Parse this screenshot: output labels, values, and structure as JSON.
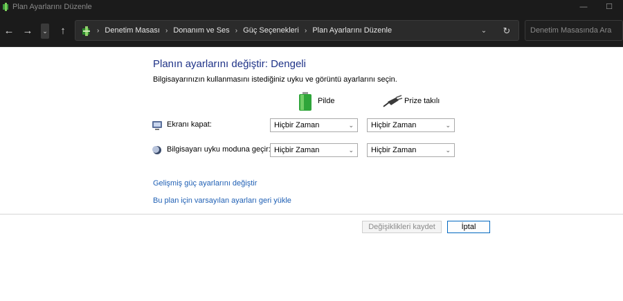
{
  "window": {
    "title": "Plan Ayarlarını Düzenle",
    "minimize_glyph": "—",
    "maximize_glyph": "☐"
  },
  "nav": {
    "back_glyph": "←",
    "forward_glyph": "→",
    "recent_glyph": "⌄",
    "up_glyph": "↑"
  },
  "address": {
    "icon": "control-panel-icon",
    "crumbs": [
      "Denetim Masası",
      "Donanım ve Ses",
      "Güç Seçenekleri",
      "Plan Ayarlarını Düzenle"
    ],
    "separator": "›",
    "dropdown_glyph": "⌄",
    "refresh_glyph": "↻"
  },
  "search": {
    "placeholder": "Denetim Masasında Ara"
  },
  "main": {
    "heading": "Planın ayarlarını değiştir: Dengeli",
    "subheading": "Bilgisayarınızın kullanmasını istediğiniz uyku ve görüntü ayarlarını seçin.",
    "columns": {
      "battery": "Pilde",
      "plugged": "Prize takılı"
    },
    "rows": {
      "display": {
        "label": "Ekranı kapat:",
        "battery_value": "Hiçbir Zaman",
        "plugged_value": "Hiçbir Zaman"
      },
      "sleep": {
        "label": "Bilgisayarı uyku moduna geçir:",
        "battery_value": "Hiçbir Zaman",
        "plugged_value": "Hiçbir Zaman"
      }
    },
    "links": {
      "advanced": "Gelişmiş güç ayarlarını değiştir",
      "restore": "Bu plan için varsayılan ayarları geri yükle"
    },
    "buttons": {
      "save": "Değişiklikleri kaydet",
      "cancel": "İptal"
    }
  },
  "colors": {
    "heading": "#1e3287",
    "link": "#1e5fb4",
    "titlebar_bg": "#1b1b1b"
  }
}
